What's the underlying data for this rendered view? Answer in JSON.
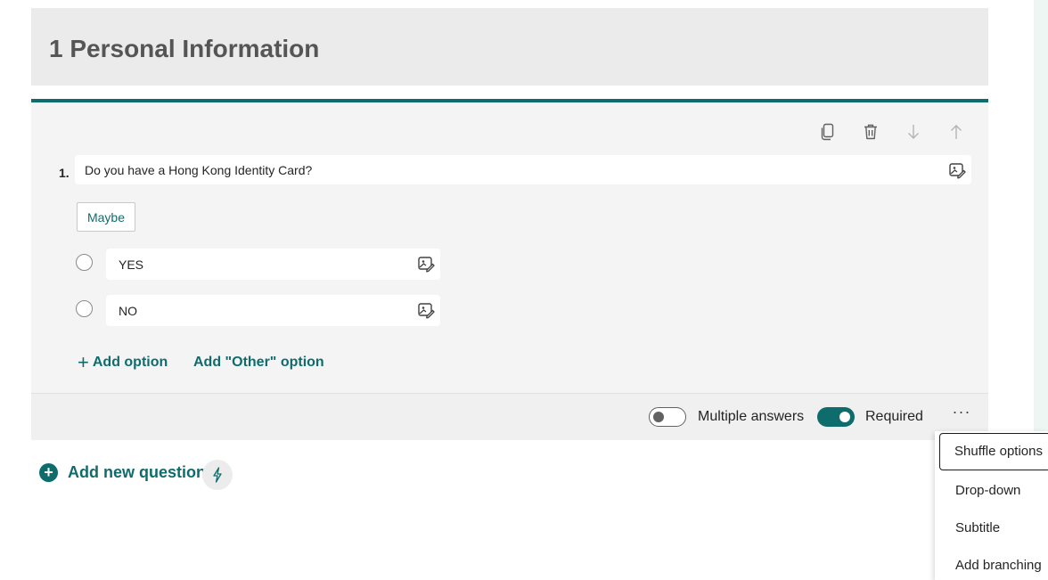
{
  "section": {
    "title": "1 Personal Information"
  },
  "question": {
    "number": "1.",
    "text": "Do you have a Hong Kong Identity Card?",
    "suggestion_chip": "Maybe",
    "options": [
      {
        "label": "YES"
      },
      {
        "label": "NO"
      }
    ],
    "add_option_label": "Add option",
    "add_other_label": "Add \"Other\" option"
  },
  "footer": {
    "multiple_answers_label": "Multiple answers",
    "multiple_answers_on": false,
    "required_label": "Required",
    "required_on": true,
    "more_label": "···"
  },
  "add_question": {
    "label": "Add new question",
    "plus": "+"
  },
  "menu": {
    "items": [
      "Shuffle options",
      "Drop-down",
      "Subtitle",
      "Add branching"
    ],
    "focused_index": 0
  },
  "colors": {
    "accent": "#0f6c6d",
    "header_bg": "#ebebeb",
    "card_bg": "#f4f4f4"
  },
  "icons": {
    "copy": "copy-icon",
    "delete": "trash-icon",
    "move_down": "arrow-down-icon",
    "move_up": "arrow-up-icon",
    "insert_media": "insert-image-icon",
    "ai_suggest": "lightning-icon"
  }
}
